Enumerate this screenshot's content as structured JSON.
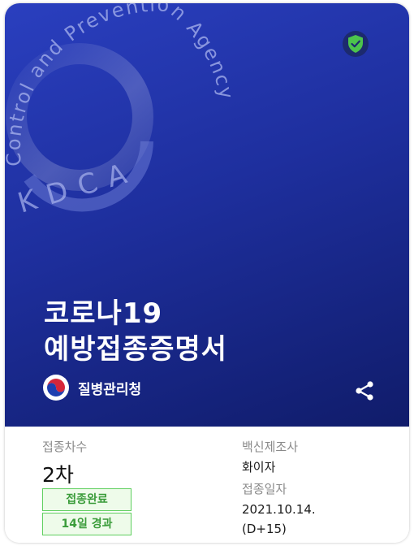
{
  "header": {
    "watermark_text_arc": "Control and Prevention Agency",
    "watermark_text_kdca": "KDCA",
    "verified_icon": "shield-check-icon"
  },
  "certificate": {
    "title_line1": "코로나19",
    "title_line2": "예방접종증명서",
    "issuer_name": "질병관리청",
    "issuer_logo_icon": "taegeuk-logo-icon",
    "share_icon": "share-icon"
  },
  "details": {
    "dose_label": "접종차수",
    "dose_value": "2차",
    "status_badge": "접종완료",
    "elapsed_badge": "14일 경과",
    "manufacturer_label": "백신제조사",
    "manufacturer_value": "화이자",
    "date_label": "접종일자",
    "date_value": "2021.10.14.",
    "date_dday": "(D+15)"
  },
  "colors": {
    "hero_bg": "#1e2f9e",
    "badge_green": "#3a9c3a",
    "shield_green": "#4cc44c"
  }
}
